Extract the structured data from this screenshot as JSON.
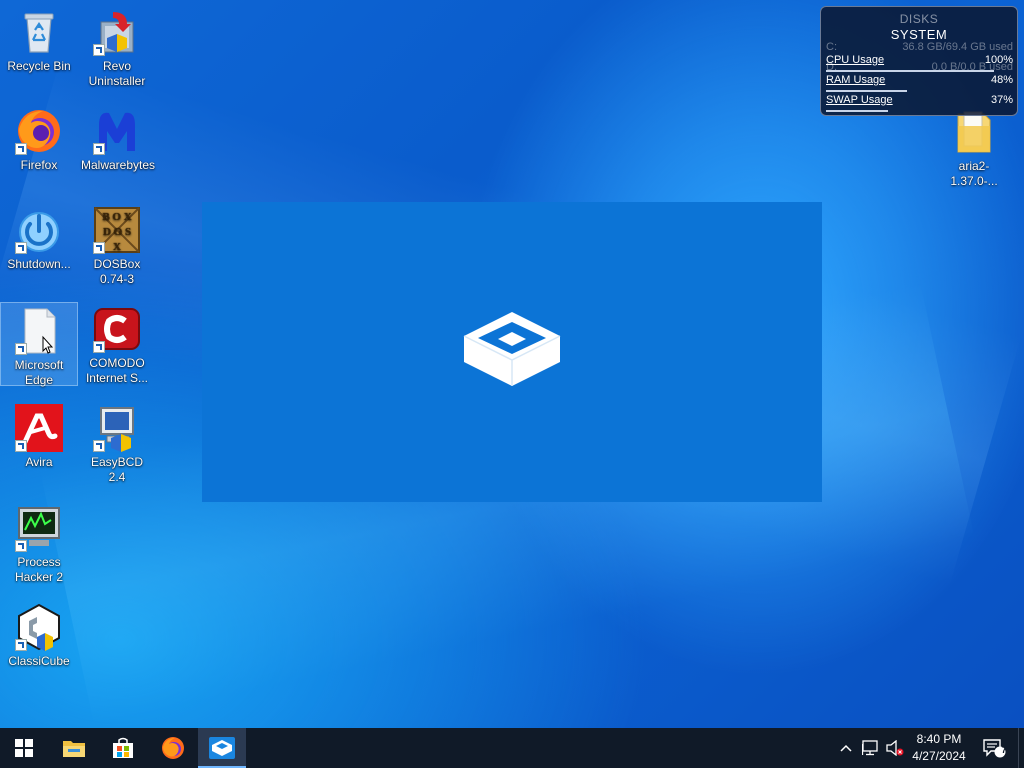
{
  "desktop": {
    "icons": [
      {
        "label": "Recycle Bin",
        "icon": "recycle-bin-icon"
      },
      {
        "label": "Revo Uninstaller",
        "icon": "revo-uninstaller-icon"
      },
      {
        "label": "Firefox",
        "icon": "firefox-icon"
      },
      {
        "label": "Malwarebytes",
        "icon": "malwarebytes-icon"
      },
      {
        "label": "Shutdown...",
        "icon": "power-icon"
      },
      {
        "label": "DOSBox 0.74-3",
        "icon": "dosbox-icon"
      },
      {
        "label": "Microsoft Edge",
        "icon": "blank-file-icon"
      },
      {
        "label": "COMODO Internet S...",
        "icon": "comodo-icon"
      },
      {
        "label": "Avira",
        "icon": "avira-icon"
      },
      {
        "label": "EasyBCD 2.4",
        "icon": "easybcd-icon"
      },
      {
        "label": "Process Hacker 2",
        "icon": "process-hacker-icon"
      },
      {
        "label": "ClassiCube",
        "icon": "classicube-icon"
      },
      {
        "label": "aria2-1.37.0-...",
        "icon": "folder-icon"
      }
    ]
  },
  "widget": {
    "disks_title": "DISKS",
    "system_title": "SYSTEM",
    "disk_rows": [
      {
        "label": "C:",
        "value": "36.8 GB/69.4 GB used"
      },
      {
        "label": "D:",
        "value": "0.0 B/0.0 B used"
      }
    ],
    "rows": [
      {
        "label": "CPU Usage",
        "value": "100%",
        "percent": 100
      },
      {
        "label": "RAM Usage",
        "value": "48%",
        "percent": 48
      },
      {
        "label": "SWAP Usage",
        "value": "37%",
        "percent": 37
      }
    ]
  },
  "center_app": {
    "icon": "sandbox-box-icon"
  },
  "taskbar": {
    "buttons": [
      "windows-start-icon",
      "file-explorer-icon",
      "microsoft-store-icon",
      "firefox-icon",
      "sandbox-app-icon"
    ],
    "active_button": "sandbox-app-icon",
    "tray": {
      "time": "8:40 PM",
      "date": "4/27/2024",
      "notification_count": "7"
    }
  },
  "colors": {
    "accent": "#0078d4",
    "taskbar": "#101a28",
    "center_panel": "#0c74d6"
  }
}
